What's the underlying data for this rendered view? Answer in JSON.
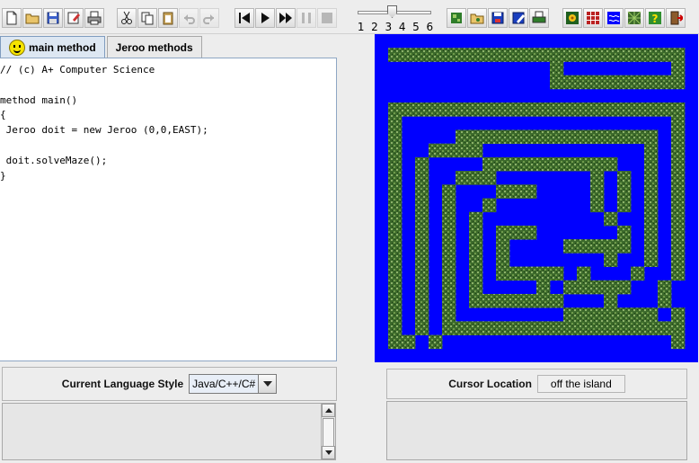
{
  "toolbar": {
    "file_tools": [
      {
        "name": "new-file-icon",
        "glyph": "new"
      },
      {
        "name": "open-file-icon",
        "glyph": "open"
      },
      {
        "name": "save-file-icon",
        "glyph": "save"
      },
      {
        "name": "save-as-icon",
        "glyph": "saveas"
      },
      {
        "name": "print-icon",
        "glyph": "print"
      }
    ],
    "edit_tools": [
      {
        "name": "cut-icon",
        "glyph": "cut",
        "enabled": true
      },
      {
        "name": "copy-icon",
        "glyph": "copy",
        "enabled": true
      },
      {
        "name": "paste-icon",
        "glyph": "paste",
        "enabled": true
      },
      {
        "name": "undo-icon",
        "glyph": "undo",
        "enabled": false
      },
      {
        "name": "redo-icon",
        "glyph": "redo",
        "enabled": false
      }
    ],
    "run_tools": [
      {
        "name": "reset-icon",
        "glyph": "reset",
        "enabled": true
      },
      {
        "name": "step-icon",
        "glyph": "step",
        "enabled": true
      },
      {
        "name": "run-icon",
        "glyph": "run",
        "enabled": true
      },
      {
        "name": "pause-icon",
        "glyph": "pause",
        "enabled": false
      },
      {
        "name": "stop-icon",
        "glyph": "stop",
        "enabled": false
      }
    ],
    "speed": {
      "ticks": [
        "1",
        "2",
        "3",
        "4",
        "5",
        "6"
      ],
      "value": 3
    },
    "island_tools": [
      {
        "name": "new-island-icon",
        "glyph": "isl-new"
      },
      {
        "name": "open-island-icon",
        "glyph": "isl-open"
      },
      {
        "name": "save-island-icon",
        "glyph": "isl-save"
      },
      {
        "name": "save-island-as-icon",
        "glyph": "isl-saveas"
      },
      {
        "name": "print-island-icon",
        "glyph": "isl-print"
      }
    ],
    "misc_tools": [
      {
        "name": "flower-icon",
        "glyph": "flower"
      },
      {
        "name": "grid-icon",
        "glyph": "grid"
      },
      {
        "name": "water-icon",
        "glyph": "water"
      },
      {
        "name": "net-icon",
        "glyph": "net"
      },
      {
        "name": "help-icon",
        "glyph": "help"
      },
      {
        "name": "exit-icon",
        "glyph": "exit"
      }
    ]
  },
  "tabs": [
    {
      "label": "main method",
      "active": true
    },
    {
      "label": "Jeroo methods",
      "active": false
    }
  ],
  "editor": {
    "lines": [
      "// (c) A+ Computer Science",
      "",
      "method main()",
      "{",
      " Jeroo doit = new Jeroo (0,0,EAST);",
      "",
      " doit.solveMaze();",
      "}"
    ]
  },
  "language_panel": {
    "label": "Current Language Style",
    "selected": "Java/C++/C#"
  },
  "cursor_panel": {
    "label": "Cursor Location",
    "value": "off the island"
  },
  "colors": {
    "water": "#0000ff",
    "net": "#4e7a35",
    "accent": "#7f9cbf"
  },
  "island": {
    "cols": 24,
    "rows": 24,
    "net_map": [
      "........................",
      ".NNNNNNNNNNNNNNNNNNNNNN.",
      ".............N........N.",
      ".............NNNNNNNNNN.",
      "........................",
      ".NNNNNNNNNNNNNNNNNNNNNN.",
      ".N....................N.",
      ".N....NNNNNNNNNNNNNNN.N.",
      ".N..NNNN............N.N.",
      ".N.N....NNNNNNNNNN..N.N.",
      ".N.N..NNN.......N.N.N.N.",
      ".N.N.N...NNN....N.N.N.N.",
      ".N.N.N..N.......N.N.N.N.",
      ".N.N.N.N.........N..N.N.",
      ".N.N.N.N.NNN......N.N.N.",
      ".N.N.N.N.N....NNNNN.N.N.",
      ".N.N.N.N.N.......N..N.N.",
      ".N.N.N.N.NNNNN.N...N..N.",
      ".N.N.N.N....N.NNNNN..N..",
      ".N.N.N.NNNNNNN...N...N..",
      ".N.N.N........NNNNNNN.N.",
      ".N.N.NNNNNNNNNNNNNNNNNN.",
      ".NN.N.................N.",
      "........................"
    ]
  }
}
